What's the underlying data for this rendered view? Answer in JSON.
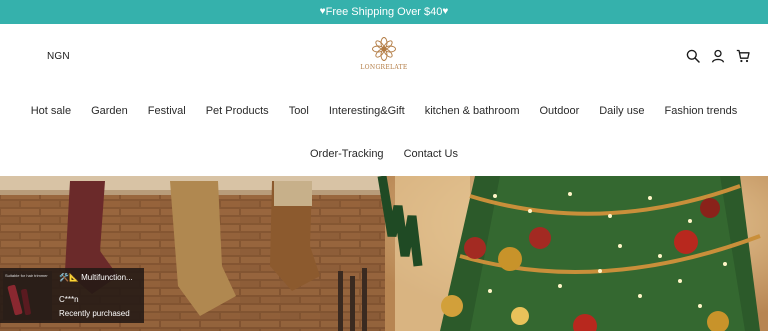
{
  "colors": {
    "accent": "#35b1ac",
    "logo": "#b27b43"
  },
  "announcement": {
    "text": "Free Shipping Over $40",
    "icon": "heart-icon"
  },
  "header": {
    "currency": "NGN",
    "logo_text": "LONGRELATE",
    "icons": [
      "search-icon",
      "account-icon",
      "cart-icon"
    ]
  },
  "nav": {
    "row1": [
      "Hot sale",
      "Garden",
      "Festival",
      "Pet Products",
      "Tool",
      "Interesting&Gift",
      "kitchen & bathroom",
      "Outdoor",
      "Daily use",
      "Fashion trends"
    ],
    "row2": [
      "Order-Tracking",
      "Contact Us"
    ]
  },
  "toast": {
    "thumb_label": "Suitable for hair trimmer",
    "product": "🛠️📐 Multifunction...",
    "customer": "C***n",
    "status": "Recently purchased"
  }
}
